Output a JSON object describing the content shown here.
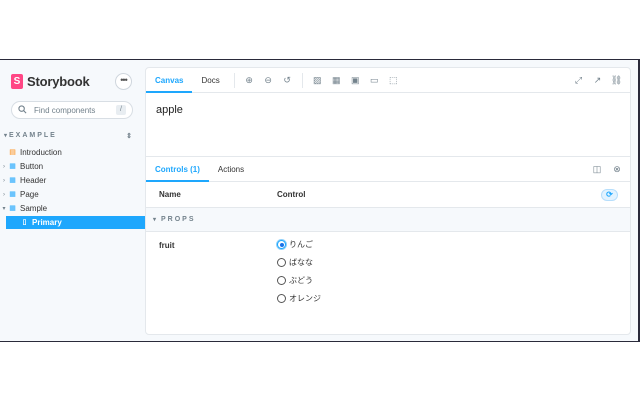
{
  "sidebar": {
    "brand": "Storybook",
    "menu_label": "•••",
    "search": {
      "placeholder": "Find components",
      "shortcut": "/"
    },
    "group": "EXAMPLE",
    "items": [
      {
        "label": "Introduction",
        "kind": "doc"
      },
      {
        "label": "Button",
        "kind": "component"
      },
      {
        "label": "Header",
        "kind": "component"
      },
      {
        "label": "Page",
        "kind": "component"
      },
      {
        "label": "Sample",
        "kind": "component",
        "expanded": true
      },
      {
        "label": "Primary",
        "kind": "story",
        "selected": true
      }
    ]
  },
  "toolbar": {
    "tabs": [
      {
        "label": "Canvas",
        "active": true
      },
      {
        "label": "Docs",
        "active": false
      }
    ]
  },
  "canvas": {
    "content": "apple"
  },
  "addons": {
    "tabs": [
      {
        "label": "Controls (1)",
        "active": true
      },
      {
        "label": "Actions",
        "active": false
      }
    ],
    "columns": {
      "name": "Name",
      "control": "Control"
    },
    "section": "PROPS",
    "prop": {
      "name": "fruit",
      "options": [
        {
          "label": "りんご",
          "checked": true
        },
        {
          "label": "ばなな",
          "checked": false
        },
        {
          "label": "ぶどう",
          "checked": false
        },
        {
          "label": "オレンジ",
          "checked": false
        }
      ]
    }
  },
  "colors": {
    "accent": "#1ea7fd",
    "brand": "#ff4785"
  }
}
